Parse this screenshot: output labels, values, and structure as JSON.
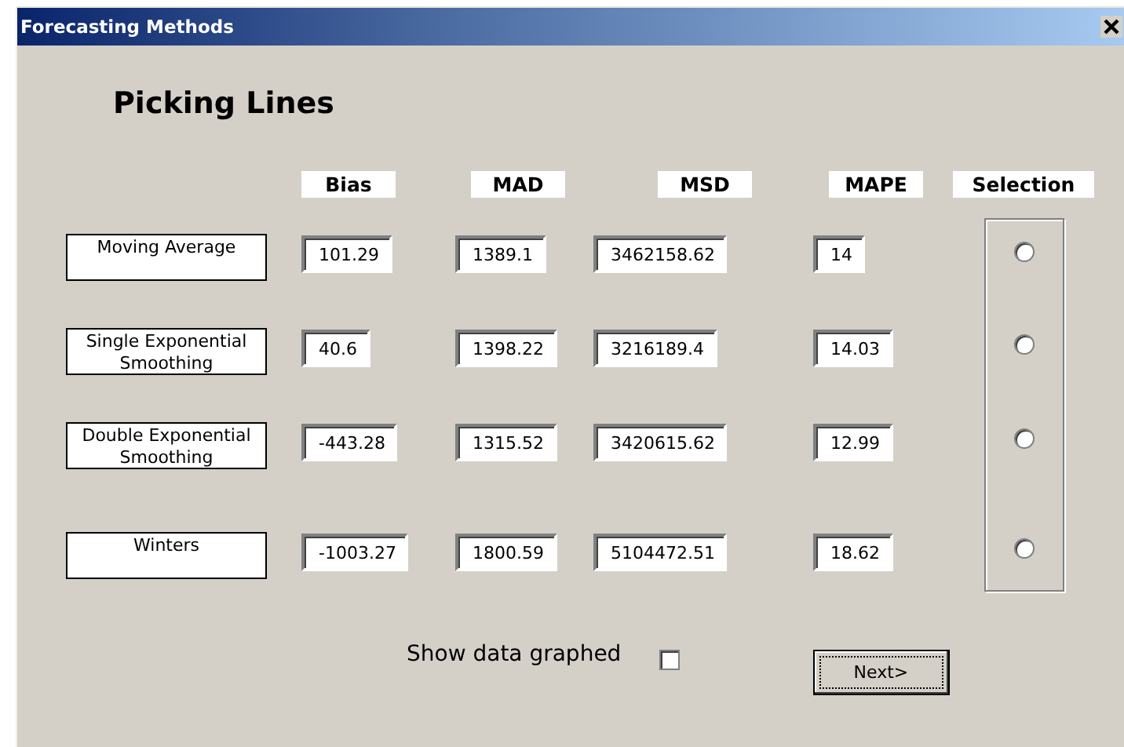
{
  "window": {
    "title": "Forecasting Methods"
  },
  "heading": "Picking Lines",
  "columns": [
    "Bias",
    "MAD",
    "MSD",
    "MAPE",
    "Selection"
  ],
  "methods": [
    {
      "name": "Moving Average",
      "bias": "101.29",
      "mad": "1389.1",
      "msd": "3462158.62",
      "mape": "14",
      "selected": false
    },
    {
      "name": "Single Exponential Smoothing",
      "bias": "40.6",
      "mad": "1398.22",
      "msd": "3216189.4",
      "mape": "14.03",
      "selected": false
    },
    {
      "name": "Double Exponential Smoothing",
      "bias": "-443.28",
      "mad": "1315.52",
      "msd": "3420615.62",
      "mape": "12.99",
      "selected": false
    },
    {
      "name": "Winters",
      "bias": "-1003.27",
      "mad": "1800.59",
      "msd": "5104472.51",
      "mape": "18.62",
      "selected": false
    }
  ],
  "show_graph": {
    "label": "Show data graphed",
    "checked": false
  },
  "buttons": [
    {
      "label": "Next>",
      "focused": true
    }
  ]
}
